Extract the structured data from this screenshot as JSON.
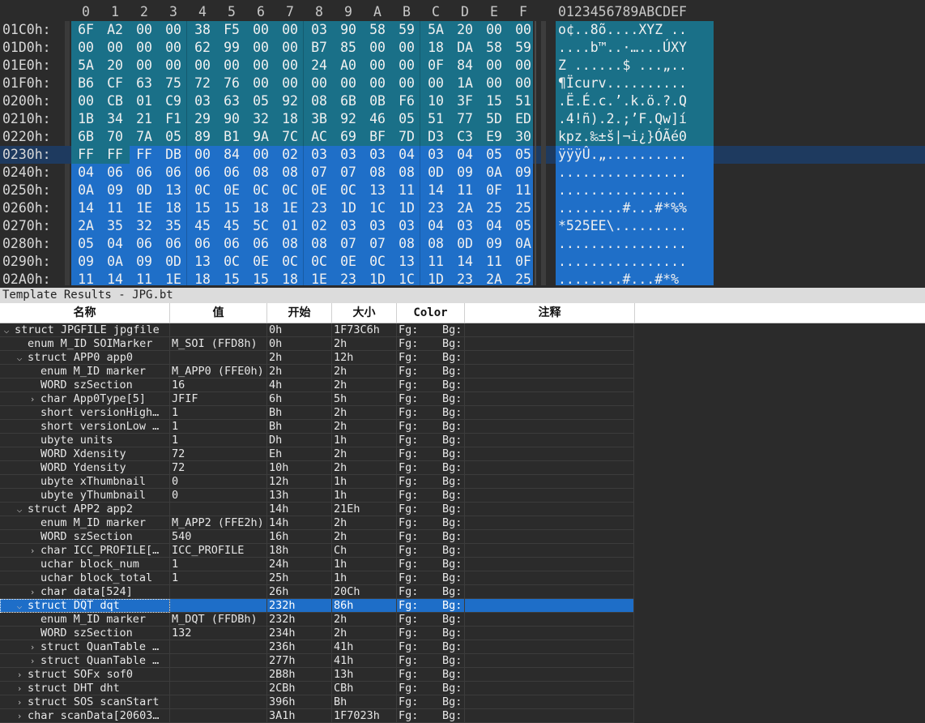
{
  "hex_editor": {
    "column_headers": [
      "0",
      "1",
      "2",
      "3",
      "4",
      "5",
      "6",
      "7",
      "8",
      "9",
      "A",
      "B",
      "C",
      "D",
      "E",
      "F"
    ],
    "ascii_header": "0123456789ABCDEF",
    "rows": [
      {
        "addr": "01C0h:",
        "bytes": [
          "6F",
          "A2",
          "00",
          "00",
          "38",
          "F5",
          "00",
          "00",
          "03",
          "90",
          "58",
          "59",
          "5A",
          "20",
          "00",
          "00"
        ],
        "ascii": "o¢..8õ....XYZ .."
      },
      {
        "addr": "01D0h:",
        "bytes": [
          "00",
          "00",
          "00",
          "00",
          "62",
          "99",
          "00",
          "00",
          "B7",
          "85",
          "00",
          "00",
          "18",
          "DA",
          "58",
          "59"
        ],
        "ascii": "....b™..·…...ÚXY"
      },
      {
        "addr": "01E0h:",
        "bytes": [
          "5A",
          "20",
          "00",
          "00",
          "00",
          "00",
          "00",
          "00",
          "24",
          "A0",
          "00",
          "00",
          "0F",
          "84",
          "00",
          "00"
        ],
        "ascii": "Z ......$ ...„.."
      },
      {
        "addr": "01F0h:",
        "bytes": [
          "B6",
          "CF",
          "63",
          "75",
          "72",
          "76",
          "00",
          "00",
          "00",
          "00",
          "00",
          "00",
          "00",
          "1A",
          "00",
          "00"
        ],
        "ascii": "¶Ïcurv.........."
      },
      {
        "addr": "0200h:",
        "bytes": [
          "00",
          "CB",
          "01",
          "C9",
          "03",
          "63",
          "05",
          "92",
          "08",
          "6B",
          "0B",
          "F6",
          "10",
          "3F",
          "15",
          "51"
        ],
        "ascii": ".Ë.É.c.’.k.ö.?.Q"
      },
      {
        "addr": "0210h:",
        "bytes": [
          "1B",
          "34",
          "21",
          "F1",
          "29",
          "90",
          "32",
          "18",
          "3B",
          "92",
          "46",
          "05",
          "51",
          "77",
          "5D",
          "ED"
        ],
        "ascii": ".4!ñ).2.;’F.Qw]í"
      },
      {
        "addr": "0220h:",
        "bytes": [
          "6B",
          "70",
          "7A",
          "05",
          "89",
          "B1",
          "9A",
          "7C",
          "AC",
          "69",
          "BF",
          "7D",
          "D3",
          "C3",
          "E9",
          "30"
        ],
        "ascii": "kpz.‰±š|¬i¿}ÓÃé0"
      },
      {
        "addr": "0230h:",
        "bytes": [
          "FF",
          "FF",
          "FF",
          "DB",
          "00",
          "84",
          "00",
          "02",
          "03",
          "03",
          "03",
          "04",
          "03",
          "04",
          "05",
          "05"
        ],
        "ascii": "ÿÿÿÛ.„.........."
      },
      {
        "addr": "0240h:",
        "bytes": [
          "04",
          "06",
          "06",
          "06",
          "06",
          "06",
          "08",
          "08",
          "07",
          "07",
          "08",
          "08",
          "0D",
          "09",
          "0A",
          "09"
        ],
        "ascii": "................"
      },
      {
        "addr": "0250h:",
        "bytes": [
          "0A",
          "09",
          "0D",
          "13",
          "0C",
          "0E",
          "0C",
          "0C",
          "0E",
          "0C",
          "13",
          "11",
          "14",
          "11",
          "0F",
          "11"
        ],
        "ascii": "................"
      },
      {
        "addr": "0260h:",
        "bytes": [
          "14",
          "11",
          "1E",
          "18",
          "15",
          "15",
          "18",
          "1E",
          "23",
          "1D",
          "1C",
          "1D",
          "23",
          "2A",
          "25",
          "25"
        ],
        "ascii": "........#...#*%%"
      },
      {
        "addr": "0270h:",
        "bytes": [
          "2A",
          "35",
          "32",
          "35",
          "45",
          "45",
          "5C",
          "01",
          "02",
          "03",
          "03",
          "03",
          "04",
          "03",
          "04",
          "05"
        ],
        "ascii": "*525EE\\........."
      },
      {
        "addr": "0280h:",
        "bytes": [
          "05",
          "04",
          "06",
          "06",
          "06",
          "06",
          "06",
          "08",
          "08",
          "07",
          "07",
          "08",
          "08",
          "0D",
          "09",
          "0A"
        ],
        "ascii": "................"
      },
      {
        "addr": "0290h:",
        "bytes": [
          "09",
          "0A",
          "09",
          "0D",
          "13",
          "0C",
          "0E",
          "0C",
          "0C",
          "0E",
          "0C",
          "13",
          "11",
          "14",
          "11",
          "0F"
        ],
        "ascii": "................"
      },
      {
        "addr": "02A0h:",
        "bytes": [
          "11",
          "14",
          "11",
          "1E",
          "18",
          "15",
          "15",
          "18",
          "1E",
          "23",
          "1D",
          "1C",
          "1D",
          "23",
          "2A",
          "25"
        ],
        "ascii": "........#...#*%"
      }
    ]
  },
  "template": {
    "title": "Template Results - JPG.bt",
    "columns": [
      "名称",
      "值",
      "开始",
      "大小",
      "Color",
      "注释"
    ],
    "rows": [
      {
        "name": "struct JPGFILE jpgfile",
        "value": "",
        "start": "0h",
        "size": "1F73C6h",
        "fg": "Fg:",
        "bg": "Bg:",
        "indent": 0,
        "arrow": "v"
      },
      {
        "name": "enum M_ID SOIMarker",
        "value": "M_SOI (FFD8h)",
        "start": "0h",
        "size": "2h",
        "fg": "Fg:",
        "bg": "Bg:",
        "indent": 1,
        "arrow": ""
      },
      {
        "name": "struct APP0 app0",
        "value": "",
        "start": "2h",
        "size": "12h",
        "fg": "Fg:",
        "bg": "Bg:",
        "indent": 1,
        "arrow": "v"
      },
      {
        "name": "enum M_ID marker",
        "value": "M_APP0 (FFE0h)",
        "start": "2h",
        "size": "2h",
        "fg": "Fg:",
        "bg": "Bg:",
        "indent": 2,
        "arrow": ""
      },
      {
        "name": "WORD szSection",
        "value": "16",
        "start": "4h",
        "size": "2h",
        "fg": "Fg:",
        "bg": "Bg:",
        "indent": 2,
        "arrow": ""
      },
      {
        "name": "char App0Type[5]",
        "value": "JFIF",
        "start": "6h",
        "size": "5h",
        "fg": "Fg:",
        "bg": "Bg:",
        "indent": 2,
        "arrow": ">"
      },
      {
        "name": "short versionHigh…",
        "value": "1",
        "start": "Bh",
        "size": "2h",
        "fg": "Fg:",
        "bg": "Bg:",
        "indent": 2,
        "arrow": ""
      },
      {
        "name": "short versionLow …",
        "value": "1",
        "start": "Bh",
        "size": "2h",
        "fg": "Fg:",
        "bg": "Bg:",
        "indent": 2,
        "arrow": ""
      },
      {
        "name": "ubyte units",
        "value": "1",
        "start": "Dh",
        "size": "1h",
        "fg": "Fg:",
        "bg": "Bg:",
        "indent": 2,
        "arrow": ""
      },
      {
        "name": "WORD Xdensity",
        "value": "72",
        "start": "Eh",
        "size": "2h",
        "fg": "Fg:",
        "bg": "Bg:",
        "indent": 2,
        "arrow": ""
      },
      {
        "name": "WORD Ydensity",
        "value": "72",
        "start": "10h",
        "size": "2h",
        "fg": "Fg:",
        "bg": "Bg:",
        "indent": 2,
        "arrow": ""
      },
      {
        "name": "ubyte xThumbnail",
        "value": "0",
        "start": "12h",
        "size": "1h",
        "fg": "Fg:",
        "bg": "Bg:",
        "indent": 2,
        "arrow": ""
      },
      {
        "name": "ubyte yThumbnail",
        "value": "0",
        "start": "13h",
        "size": "1h",
        "fg": "Fg:",
        "bg": "Bg:",
        "indent": 2,
        "arrow": ""
      },
      {
        "name": "struct APP2 app2",
        "value": "",
        "start": "14h",
        "size": "21Eh",
        "fg": "Fg:",
        "bg": "Bg:",
        "indent": 1,
        "arrow": "v"
      },
      {
        "name": "enum M_ID marker",
        "value": "M_APP2 (FFE2h)",
        "start": "14h",
        "size": "2h",
        "fg": "Fg:",
        "bg": "Bg:",
        "indent": 2,
        "arrow": ""
      },
      {
        "name": "WORD szSection",
        "value": "540",
        "start": "16h",
        "size": "2h",
        "fg": "Fg:",
        "bg": "Bg:",
        "indent": 2,
        "arrow": ""
      },
      {
        "name": "char ICC_PROFILE[…",
        "value": "ICC_PROFILE",
        "start": "18h",
        "size": "Ch",
        "fg": "Fg:",
        "bg": "Bg:",
        "indent": 2,
        "arrow": ">"
      },
      {
        "name": "uchar block_num",
        "value": "1",
        "start": "24h",
        "size": "1h",
        "fg": "Fg:",
        "bg": "Bg:",
        "indent": 2,
        "arrow": ""
      },
      {
        "name": "uchar block_total",
        "value": "1",
        "start": "25h",
        "size": "1h",
        "fg": "Fg:",
        "bg": "Bg:",
        "indent": 2,
        "arrow": ""
      },
      {
        "name": "char data[524]",
        "value": "",
        "start": "26h",
        "size": "20Ch",
        "fg": "Fg:",
        "bg": "Bg:",
        "indent": 2,
        "arrow": ">"
      },
      {
        "name": "struct DQT dqt",
        "value": "",
        "start": "232h",
        "size": "86h",
        "fg": "Fg:",
        "bg": "Bg:",
        "indent": 1,
        "arrow": "v",
        "selected": true
      },
      {
        "name": "enum M_ID marker",
        "value": "M_DQT (FFDBh)",
        "start": "232h",
        "size": "2h",
        "fg": "Fg:",
        "bg": "Bg:",
        "indent": 2,
        "arrow": ""
      },
      {
        "name": "WORD szSection",
        "value": "132",
        "start": "234h",
        "size": "2h",
        "fg": "Fg:",
        "bg": "Bg:",
        "indent": 2,
        "arrow": ""
      },
      {
        "name": "struct QuanTable …",
        "value": "",
        "start": "236h",
        "size": "41h",
        "fg": "Fg:",
        "bg": "Bg:",
        "indent": 2,
        "arrow": ">"
      },
      {
        "name": "struct QuanTable …",
        "value": "",
        "start": "277h",
        "size": "41h",
        "fg": "Fg:",
        "bg": "Bg:",
        "indent": 2,
        "arrow": ">"
      },
      {
        "name": "struct SOFx sof0",
        "value": "",
        "start": "2B8h",
        "size": "13h",
        "fg": "Fg:",
        "bg": "Bg:",
        "indent": 1,
        "arrow": ">"
      },
      {
        "name": "struct DHT dht",
        "value": "",
        "start": "2CBh",
        "size": "CBh",
        "fg": "Fg:",
        "bg": "Bg:",
        "indent": 1,
        "arrow": ">"
      },
      {
        "name": "struct SOS scanStart",
        "value": "",
        "start": "396h",
        "size": "Bh",
        "fg": "Fg:",
        "bg": "Bg:",
        "indent": 1,
        "arrow": ">"
      },
      {
        "name": "char scanData[20603…",
        "value": "",
        "start": "3A1h",
        "size": "1F7023h",
        "fg": "Fg:",
        "bg": "Bg:",
        "indent": 1,
        "arrow": ">"
      }
    ]
  },
  "colors": {
    "teal_region": "#1a7088",
    "blue_region": "#1f6fc8",
    "selected_row": "#1e6ec8",
    "cursor_row": "#1e3a5f"
  }
}
